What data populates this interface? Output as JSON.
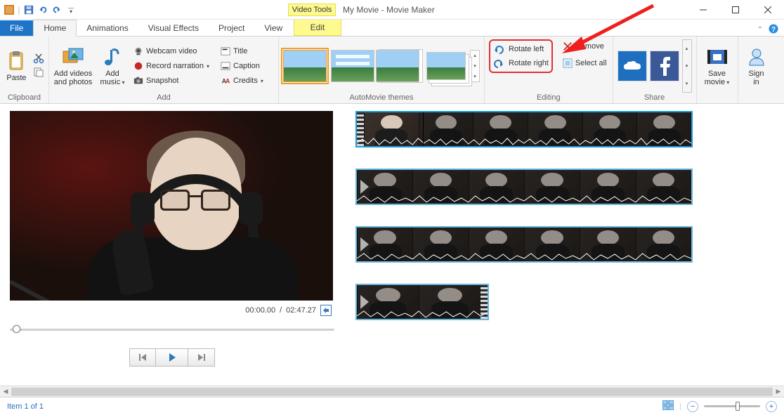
{
  "titlebar": {
    "videotools": "Video Tools",
    "title": "My Movie - Movie Maker"
  },
  "tabs": {
    "file": "File",
    "home": "Home",
    "animations": "Animations",
    "visual_effects": "Visual Effects",
    "project": "Project",
    "view": "View",
    "edit": "Edit"
  },
  "ribbon": {
    "clipboard": {
      "paste": "Paste",
      "label": "Clipboard"
    },
    "add": {
      "add_videos": "Add videos\nand photos",
      "add_music": "Add\nmusic",
      "webcam": "Webcam video",
      "record": "Record narration",
      "snapshot": "Snapshot",
      "title": "Title",
      "caption": "Caption",
      "credits": "Credits",
      "label": "Add"
    },
    "automovie_label": "AutoMovie themes",
    "editing": {
      "rotate_left": "Rotate left",
      "rotate_right": "Rotate right",
      "remove": "Remove",
      "select_all": "Select all",
      "label": "Editing"
    },
    "share": {
      "label": "Share"
    },
    "save_movie": "Save\nmovie",
    "sign_in": "Sign\nin"
  },
  "preview": {
    "time_current": "00:00.00",
    "time_total": "02:47.27"
  },
  "status": {
    "item_text": "Item 1 of 1"
  }
}
